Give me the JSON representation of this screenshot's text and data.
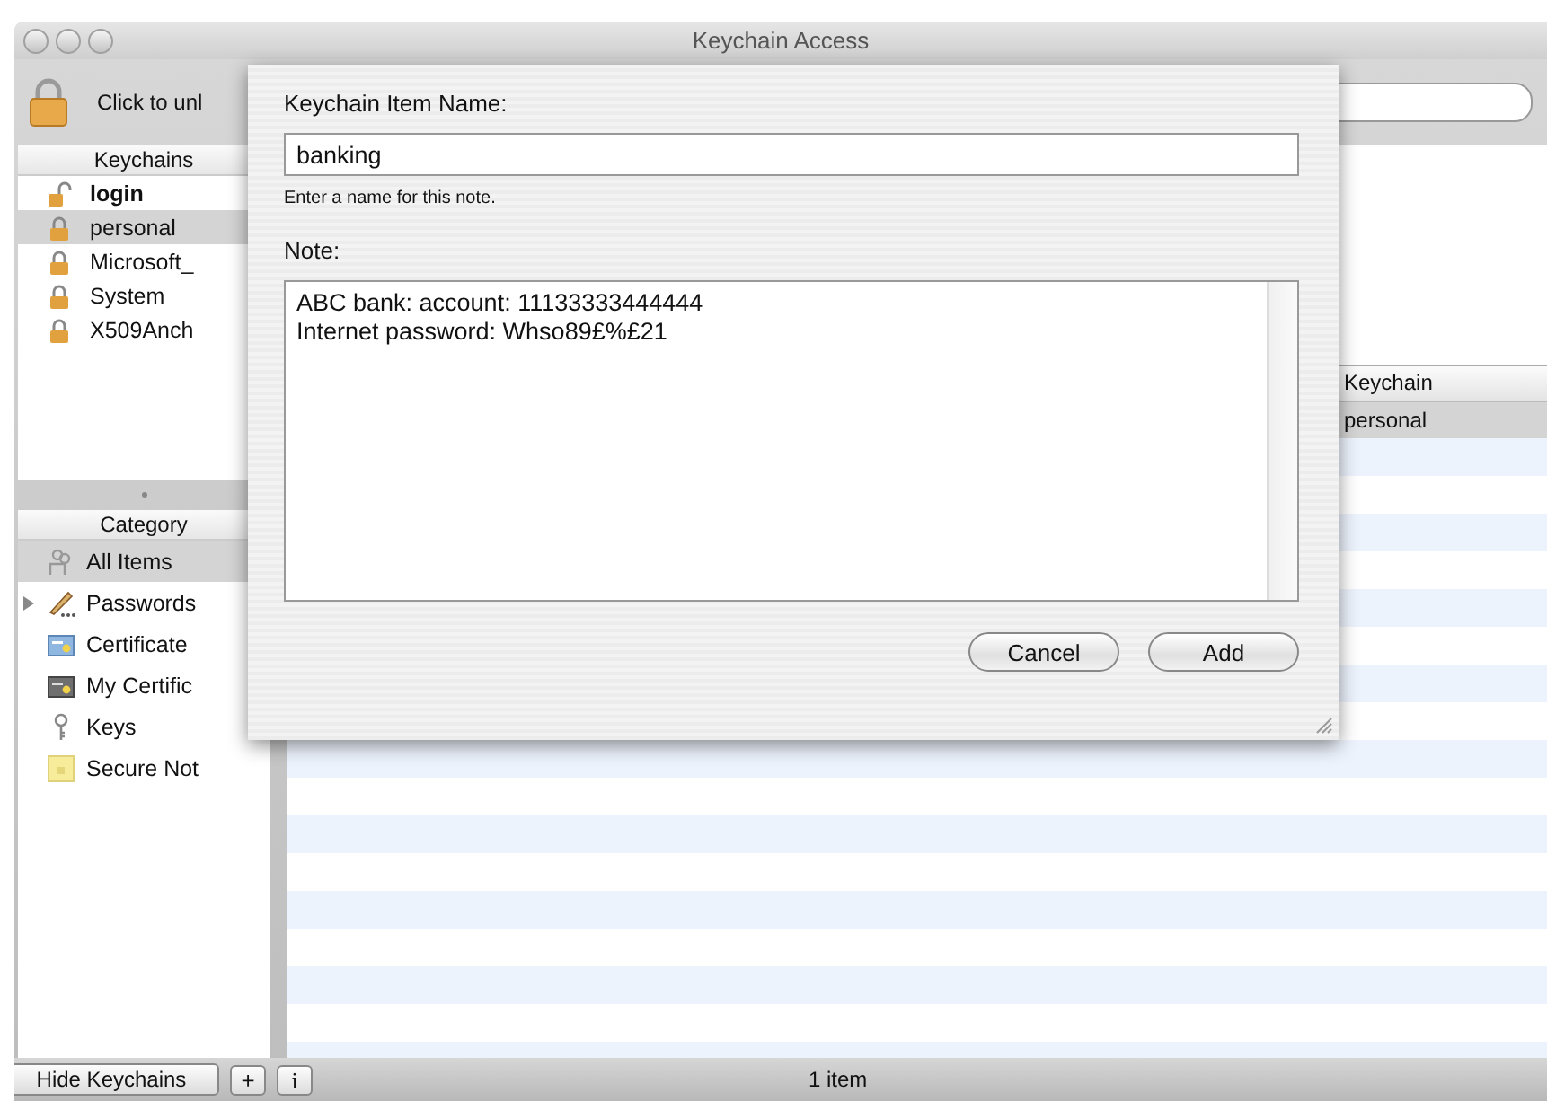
{
  "window": {
    "title": "Keychain Access"
  },
  "toolbar": {
    "lock_label": "Click to unl"
  },
  "keychains": {
    "header": "Keychains",
    "items": [
      {
        "name": "login",
        "kind": "unlocked",
        "default": true,
        "selected": false
      },
      {
        "name": "personal",
        "kind": "locked",
        "default": false,
        "selected": true
      },
      {
        "name": "Microsoft_",
        "kind": "locked",
        "default": false,
        "selected": false
      },
      {
        "name": "System",
        "kind": "locked",
        "default": false,
        "selected": false
      },
      {
        "name": "X509Anch",
        "kind": "locked",
        "default": false,
        "selected": false
      }
    ]
  },
  "category": {
    "header": "Category",
    "items": [
      {
        "name": "All Items",
        "kind": "people",
        "selected": true
      },
      {
        "name": "Passwords",
        "kind": "pencil",
        "selected": false,
        "expanded": false
      },
      {
        "name": "Certificate",
        "kind": "certificate",
        "selected": false
      },
      {
        "name": "My Certific",
        "kind": "my-certificate",
        "selected": false
      },
      {
        "name": "Keys",
        "kind": "key",
        "selected": false
      },
      {
        "name": "Secure Not",
        "kind": "note",
        "selected": false
      }
    ]
  },
  "table": {
    "columns": [
      {
        "label": "Keychain"
      }
    ],
    "rows": [
      {
        "cells": [
          "personal"
        ],
        "selected": true
      }
    ]
  },
  "sheet": {
    "name_label": "Keychain Item Name:",
    "name_value": "banking",
    "hint": "Enter a name for this note.",
    "note_label": "Note:",
    "note_value": "ABC bank: account: 11133333444444\nInternet password: Whso89£%£21",
    "buttons": [
      "Cancel",
      "Add"
    ]
  },
  "bottom_bar": {
    "hide_button": "Hide Keychains",
    "add_button": "+",
    "info_button": "i",
    "status": "1 item"
  }
}
